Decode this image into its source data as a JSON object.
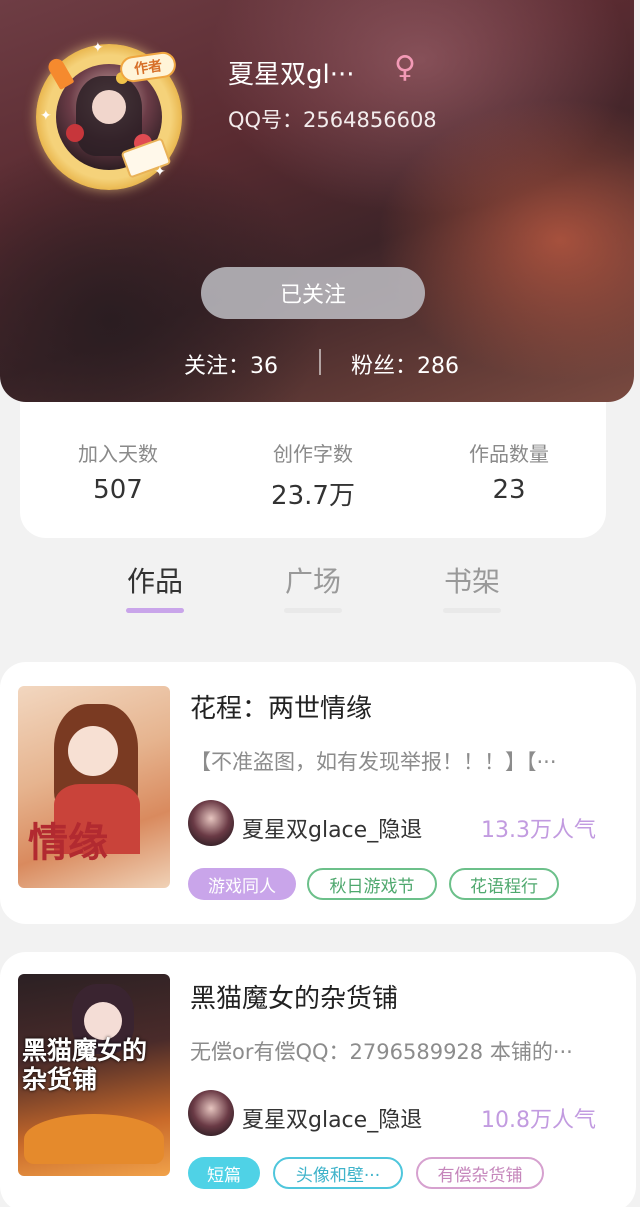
{
  "profile": {
    "author_badge": "作者",
    "username": "夏星双gl···",
    "gender_symbol": "♀",
    "qq": "QQ号：2564856608",
    "follow_button": "已关注",
    "following": "关注：36",
    "fans": "粉丝：286"
  },
  "stats": [
    {
      "label": "加入天数",
      "value": "507"
    },
    {
      "label": "创作字数",
      "value": "23.7万"
    },
    {
      "label": "作品数量",
      "value": "23"
    }
  ],
  "tabs": [
    {
      "label": "作品",
      "active": true
    },
    {
      "label": "广场",
      "active": false
    },
    {
      "label": "书架",
      "active": false
    }
  ],
  "works": [
    {
      "title": "花程：两世情缘",
      "cover_text": "情缘",
      "description": "【不准盗图，如有发现举报！！！】【···",
      "author": "夏星双glace_隐退",
      "popularity": "13.3万人气",
      "tags": [
        "游戏同人",
        "秋日游戏节",
        "花语程行"
      ]
    },
    {
      "title": "黑猫魔女的杂货铺",
      "cover_text": "黑猫魔女的杂货铺",
      "description": "无偿or有偿QQ：2796589928 本铺的···",
      "author": "夏星双glace_隐退",
      "popularity": "10.8万人气",
      "tags": [
        "短篇",
        "头像和壁···",
        "有偿杂货铺"
      ]
    }
  ],
  "colors": {
    "accent_purple": "#c29be0",
    "tag_purple_fill": "#c9a5ea",
    "tag_green": "#6cc08a",
    "tag_cyan_fill": "#4fd2e6",
    "tag_cyan_outline": "#4fc6dc",
    "tag_pink_outline": "#d6a1cf",
    "gender_pink": "#f39ab6"
  }
}
